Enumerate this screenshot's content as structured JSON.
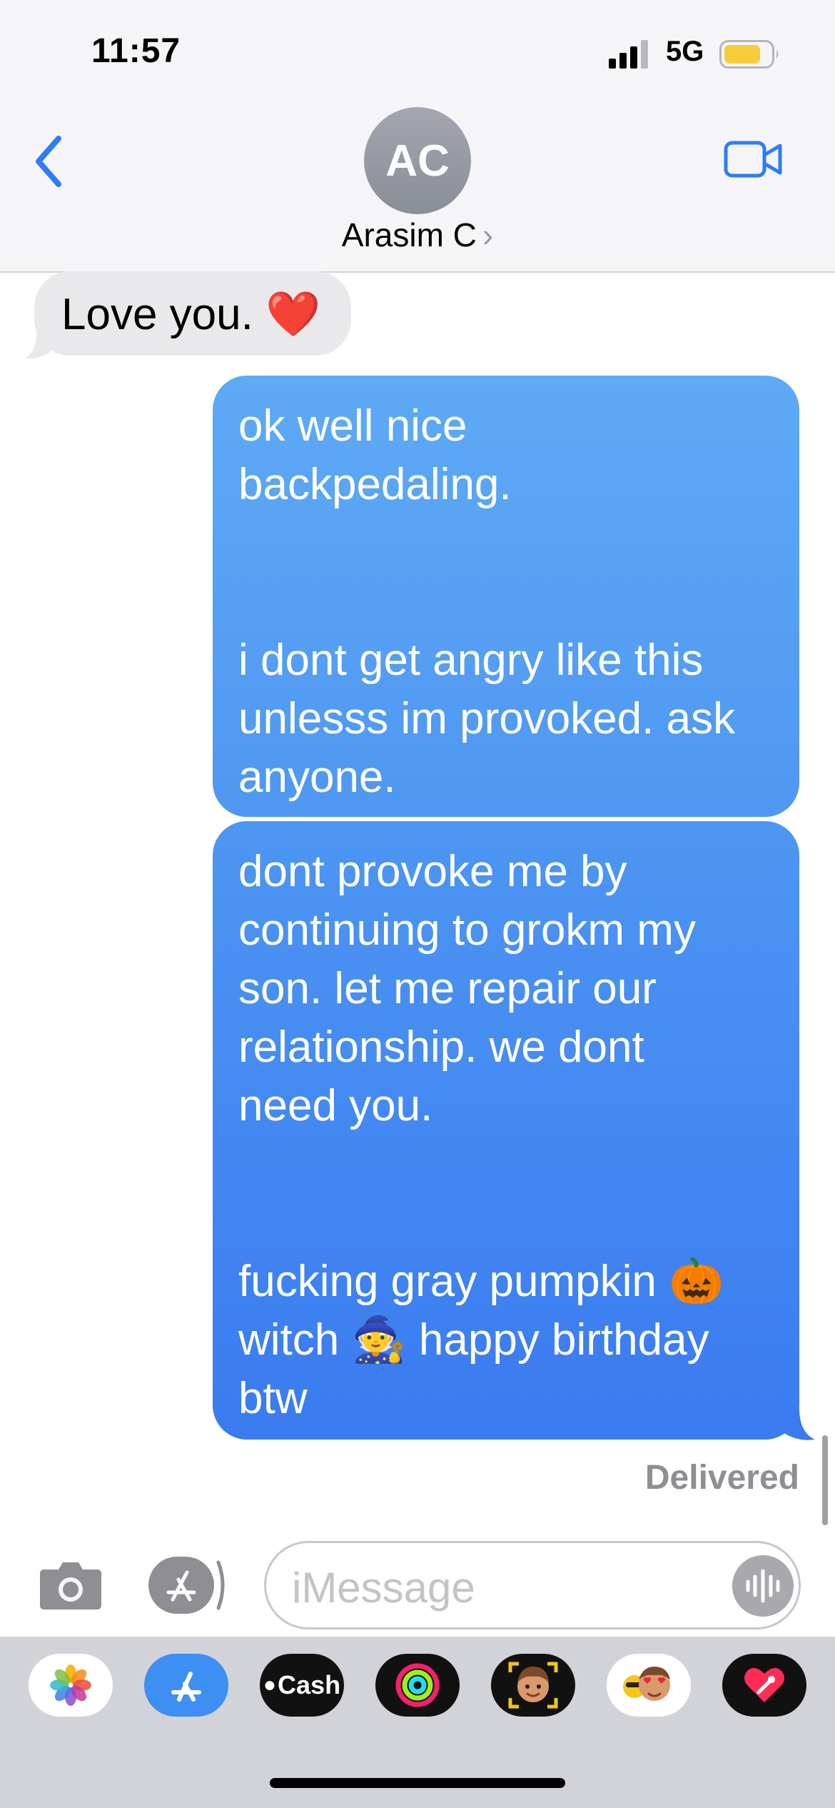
{
  "status_bar": {
    "time": "11:57",
    "network": "5G",
    "signal_icon": "cellular-signal-icon",
    "battery_icon": "battery-icon",
    "battery_color": "#f6cc3a"
  },
  "header": {
    "avatar_initials": "AC",
    "contact_name": "Arasim C",
    "chevron": "›",
    "accent_color": "#2f7cf6"
  },
  "messages": [
    {
      "direction": "incoming",
      "text": "Love you. ❤️"
    },
    {
      "direction": "outgoing",
      "text": "ok well nice\nbackpedaling.\n\n\ni dont get angry like this\nunlesss im provoked. ask\nanyone."
    },
    {
      "direction": "outgoing",
      "text": "dont provoke me by\ncontinuing to grokm my\nson. let me repair our\nrelationship. we dont\nneed you.\n\n\nfucking gray pumpkin 🎃\nwitch 🧙 happy birthday\nbtw"
    }
  ],
  "delivery_status": "Delivered",
  "input_bar": {
    "placeholder": "iMessage"
  },
  "app_drawer": [
    {
      "name": "photos-app-icon"
    },
    {
      "name": "app-store-icon"
    },
    {
      "name": "cash-app-icon",
      "label": "Cash"
    },
    {
      "name": "fitness-app-icon"
    },
    {
      "name": "memoji-app-icon"
    },
    {
      "name": "memoji-stickers-icon"
    },
    {
      "name": "digital-touch-icon"
    }
  ]
}
